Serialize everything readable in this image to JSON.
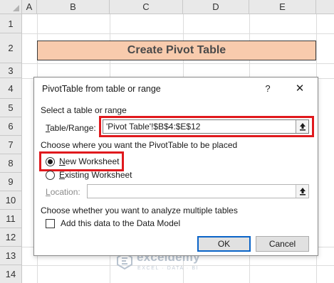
{
  "sheet": {
    "columns": [
      "A",
      "B",
      "C",
      "D",
      "E"
    ],
    "rows": [
      "1",
      "2",
      "3",
      "4",
      "5",
      "6",
      "7",
      "8",
      "9",
      "10",
      "11",
      "12",
      "13",
      "14"
    ],
    "title_cell": "Create Pivot Table"
  },
  "dialog": {
    "title": "PivotTable from table or range",
    "help_label": "?",
    "close_label": "✕",
    "section_select": "Select a table or range",
    "table_range_label": "Table/Range:",
    "table_range_value": "'Pivot Table'!$B$4:$E$12",
    "section_placement": "Choose where you want the PivotTable to be placed",
    "new_worksheet_label": "New Worksheet",
    "new_worksheet_checked": true,
    "existing_worksheet_label": "Existing Worksheet",
    "existing_worksheet_checked": false,
    "location_label": "Location:",
    "location_value": "",
    "section_multiple": "Choose whether you want to analyze multiple tables",
    "data_model_label": "Add this data to the Data Model",
    "data_model_checked": false,
    "ok_label": "OK",
    "cancel_label": "Cancel"
  },
  "watermark": {
    "name": "exceldemy",
    "tagline": "EXCEL · DATA · BI"
  },
  "colors": {
    "title_fill": "#f8cbad",
    "highlight": "#e0191d",
    "marquee": "#1d7a45",
    "default_button_border": "#0a64c8"
  },
  "icons": {
    "collapse": "range-collapse-icon",
    "logo": "exceldemy-logo-icon"
  }
}
